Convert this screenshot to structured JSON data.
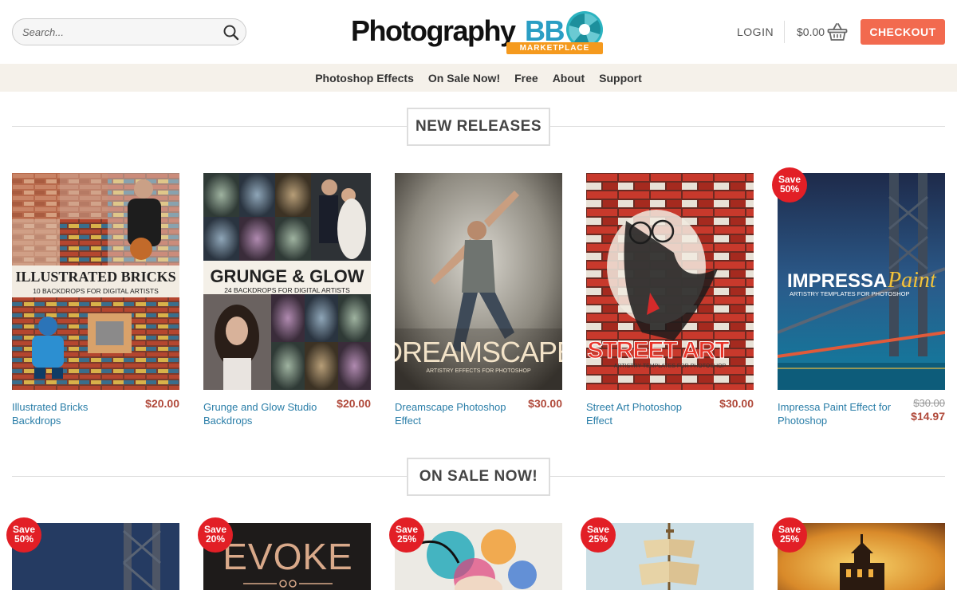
{
  "header": {
    "search_placeholder": "Search...",
    "logo_text": "Photography",
    "logo_bb": "BB",
    "logo_sub": "MARKETPLACE",
    "login_label": "LOGIN",
    "cart_total": "$0.00",
    "checkout_label": "CHECKOUT"
  },
  "nav": {
    "items": [
      {
        "label": "Photoshop Effects"
      },
      {
        "label": "On Sale Now!"
      },
      {
        "label": "Free"
      },
      {
        "label": "About"
      },
      {
        "label": "Support"
      }
    ]
  },
  "new_releases": {
    "title": "NEW RELEASES",
    "products": [
      {
        "name": "Illustrated Bricks Backdrops",
        "price": "$20.00",
        "cover_title": "ILLUSTRATED BRICKS",
        "cover_sub": "10 BACKDROPS FOR DIGITAL ARTISTS"
      },
      {
        "name": "Grunge and Glow Studio Backdrops",
        "price": "$20.00",
        "cover_title": "GRUNGE & GLOW",
        "cover_sub": "24 BACKDROPS FOR DIGITAL ARTISTS"
      },
      {
        "name": "Dreamscape Photoshop Effect",
        "price": "$30.00",
        "cover_title": "DREAMSCAPE",
        "cover_sub": "ARTISTRY EFFECTS FOR PHOTOSHOP"
      },
      {
        "name": "Street Art Photoshop Effect",
        "price": "$30.00",
        "cover_title": "STREET ART",
        "cover_sub": "ARTISTRY TEMPLATES FOR PHOTOSHOP"
      },
      {
        "name": "Impressa Paint Effect for Photoshop",
        "old_price": "$30.00",
        "price": "$14.97",
        "badge_line1": "Save",
        "badge_line2": "50%",
        "cover_title": "IMPRESSA",
        "cover_title2": "Paint",
        "cover_sub": "ARTISTRY TEMPLATES FOR PHOTOSHOP"
      }
    ]
  },
  "on_sale": {
    "title": "ON SALE NOW!",
    "items": [
      {
        "badge_line1": "Save",
        "badge_line2": "50%"
      },
      {
        "badge_line1": "Save",
        "badge_line2": "20%",
        "cover_title": "EVOKE"
      },
      {
        "badge_line1": "Save",
        "badge_line2": "25%"
      },
      {
        "badge_line1": "Save",
        "badge_line2": "25%"
      },
      {
        "badge_line1": "Save",
        "badge_line2": "25%"
      }
    ]
  },
  "colors": {
    "accent": "#f26a4f",
    "link": "#2a7ea8",
    "price": "#b0493a",
    "badge": "#e21f26",
    "nav_bg": "#f5f1ea"
  },
  "icons": {
    "search": "search-icon",
    "cart": "basket-icon"
  }
}
